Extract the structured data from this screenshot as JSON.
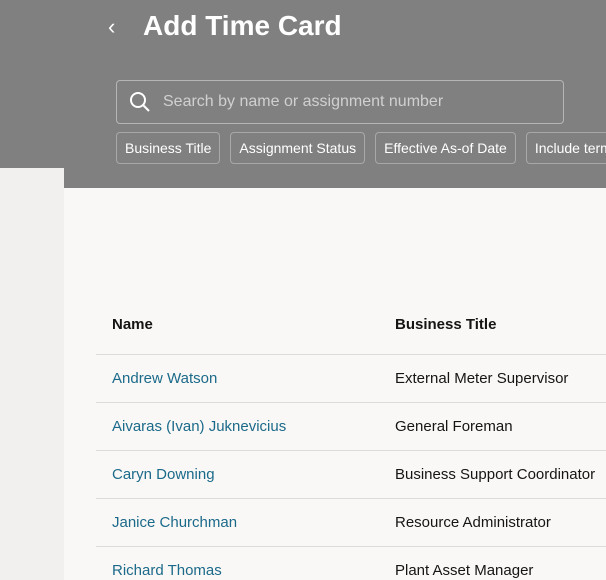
{
  "header": {
    "back_icon": "chevron-left-icon",
    "title": "Add Time Card"
  },
  "search": {
    "placeholder": "Search by name or assignment number",
    "value": ""
  },
  "filters": [
    "Business Title",
    "Assignment Status",
    "Effective As-of Date",
    "Include term"
  ],
  "table": {
    "columns": [
      "Name",
      "Business Title"
    ],
    "rows": [
      {
        "name": "Andrew Watson",
        "title": "External Meter Supervisor"
      },
      {
        "name": "Aivaras (Ivan) Juknevicius",
        "title": "General Foreman"
      },
      {
        "name": "Caryn Downing",
        "title": "Business Support Coordinator"
      },
      {
        "name": "Janice Churchman",
        "title": "Resource Administrator"
      },
      {
        "name": "Richard Thomas",
        "title": "Plant Asset Manager"
      }
    ]
  }
}
